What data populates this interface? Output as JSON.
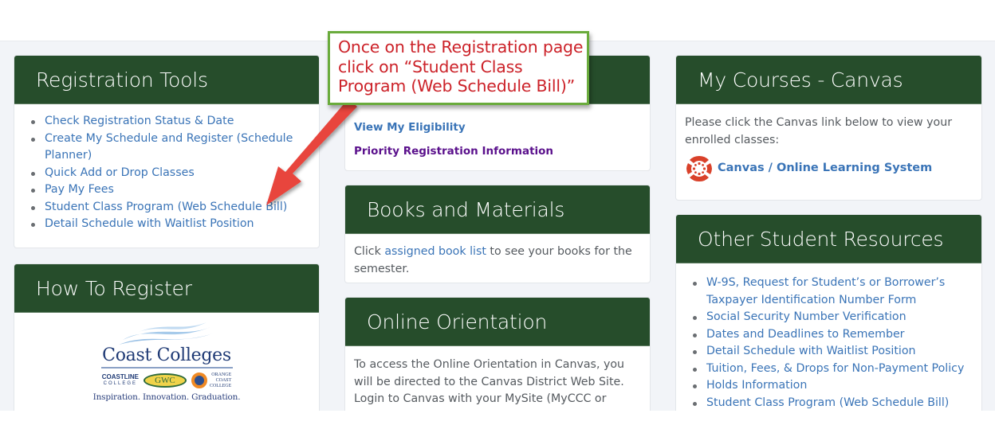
{
  "callout": {
    "text": "Once on the Registration page click on “Student Class Program (Web Schedule Bill)”",
    "border_color": "#6aab3c",
    "text_color": "#cc2229",
    "arrow_color": "#e8453c"
  },
  "colors": {
    "header_bg": "#264d2b",
    "link": "#3a74b7",
    "link_visited": "#5a108c",
    "page_bg": "#f2f4f8"
  },
  "registration_tools": {
    "title": "Registration Tools",
    "items": [
      "Check Registration Status & Date",
      "Create My Schedule and Register (Schedule Planner)",
      "Quick Add or Drop Classes",
      "Pay My Fees",
      "Student Class Program (Web Schedule Bill)",
      "Detail Schedule with Waitlist Position"
    ]
  },
  "how_to_register": {
    "title": "How To Register",
    "logo": {
      "title": "Coast Colleges",
      "coastline": "COASTLINE",
      "coastline_sub": "COLLEGE",
      "gwc": "GWC",
      "occ": [
        "ORANGE",
        "COAST",
        "COLLEGE"
      ],
      "tagline": "Inspiration. Innovation. Graduation."
    }
  },
  "eligibility": {
    "links": [
      "View My Eligibility",
      "Priority Registration Information"
    ]
  },
  "books": {
    "title": "Books and Materials",
    "text_before": "Click ",
    "link": "assigned book list",
    "text_after": " to see your books for the semester."
  },
  "orientation": {
    "title": "Online Orientation",
    "text": "To access the Online Orientation in Canvas, you will be directed to the Canvas District Web Site. Login to Canvas with your MySite (MyCCC or MyGWC or MyOCC)"
  },
  "canvas": {
    "title": "My Courses - Canvas",
    "text": "Please click the Canvas link below to view your enrolled classes:",
    "link": "Canvas / Online Learning System",
    "icon": "canvas-logo-icon"
  },
  "other_resources": {
    "title": "Other Student Resources",
    "items": [
      "W-9S, Request for Student’s or Borrower’s Taxpayer Identification Number Form",
      "Social Security Number Verification",
      "Dates and Deadlines to Remember",
      "Detail Schedule with Waitlist Position",
      "Tuition, Fees, & Drops for Non-Payment Policy",
      "Holds Information",
      "Student Class Program (Web Schedule Bill)"
    ]
  }
}
